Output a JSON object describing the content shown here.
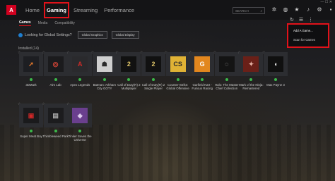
{
  "topbar": {
    "logo_text": "A",
    "nav": [
      {
        "label": "Home",
        "active": false
      },
      {
        "label": "Gaming",
        "active": true
      },
      {
        "label": "Streaming",
        "active": false
      },
      {
        "label": "Performance",
        "active": false
      }
    ],
    "search_placeholder": "SEARCH",
    "icons": [
      "bug-icon",
      "web-icon",
      "star-icon",
      "bell-icon",
      "gear-icon",
      "profile-icon"
    ]
  },
  "subnav": [
    "Games",
    "Media",
    "Compatibility"
  ],
  "prompt": {
    "text": "Looking for Global Settings?",
    "buttons": [
      "Global Graphics",
      "Global Display"
    ]
  },
  "section_label": "Installed (14)",
  "games": [
    {
      "name": "3DMark",
      "color": "#1d1e22",
      "glyph": "➚",
      "fg": "#e67a2c"
    },
    {
      "name": "Aim Lab",
      "color": "#1b1b1d",
      "glyph": "◎",
      "fg": "#e14838"
    },
    {
      "name": "Apex Legends",
      "color": "#2a2a2d",
      "glyph": "A",
      "fg": "#c92b28"
    },
    {
      "name": "Batman: Arkham City GOTY",
      "color": "#cfcfcf",
      "glyph": "☗",
      "fg": "#2a2a2a"
    },
    {
      "name": "Call of Duty(R) 2 Multiplayer",
      "color": "#111",
      "glyph": "2",
      "fg": "#e3c86a"
    },
    {
      "name": "Call of Duty(R) 2 Single Player",
      "color": "#111",
      "glyph": "2",
      "fg": "#e3c86a"
    },
    {
      "name": "Counter-Strike: Global Offensive",
      "color": "#e0b235",
      "glyph": "CS",
      "fg": "#2a2a2a"
    },
    {
      "name": "Garfield Kart - Furious Racing",
      "color": "#e2871e",
      "glyph": "G",
      "fg": "#fff"
    },
    {
      "name": "Halo: The Master Chief Collection",
      "color": "#141414",
      "glyph": "◌",
      "fg": "#d9d9d9"
    },
    {
      "name": "Mark of the Ninja: Remastered",
      "color": "#6a2018",
      "glyph": "✦",
      "fg": "#e6b1a4"
    },
    {
      "name": "Max Payne 3",
      "color": "#101010",
      "glyph": "◖",
      "fg": "#ffffff"
    },
    {
      "name": "Super Meat Boy",
      "color": "#1a1a1c",
      "glyph": "▣",
      "fg": "#cf2828"
    },
    {
      "name": "Thimbleweed Park",
      "color": "#1c1c1e",
      "glyph": "▤",
      "fg": "#aaaaaa"
    },
    {
      "name": "Tinker Saves the Universe",
      "color": "#6a3f8e",
      "glyph": "◈",
      "fg": "#e3d2f2"
    }
  ],
  "games_extra_labels": {
    "batman": "Batman: Arkham City GOTY",
    "cod2mp": "Call of Duty(R) 2 Multiplayer",
    "cod2sp": "Call of Duty(R) 2 Single Player",
    "csgo": "Counter-Strike: Global Offensive",
    "garfield": "Garfield Kart - Furious Racing",
    "halo": "Halo: The Master Chief Collection",
    "ninja": "Mark of the Ninja: Remastered",
    "maxpayne": "Max Payne 3",
    "smb": "Super Meat Boy",
    "thimble": "Thimbleweed Park",
    "tinker": "Tinker Saves the Universe"
  },
  "dropdown": [
    "Add A Game...",
    "Scan for Games"
  ],
  "right_controls": [
    "refresh-icon",
    "list-view-icon",
    "more-options-icon"
  ]
}
